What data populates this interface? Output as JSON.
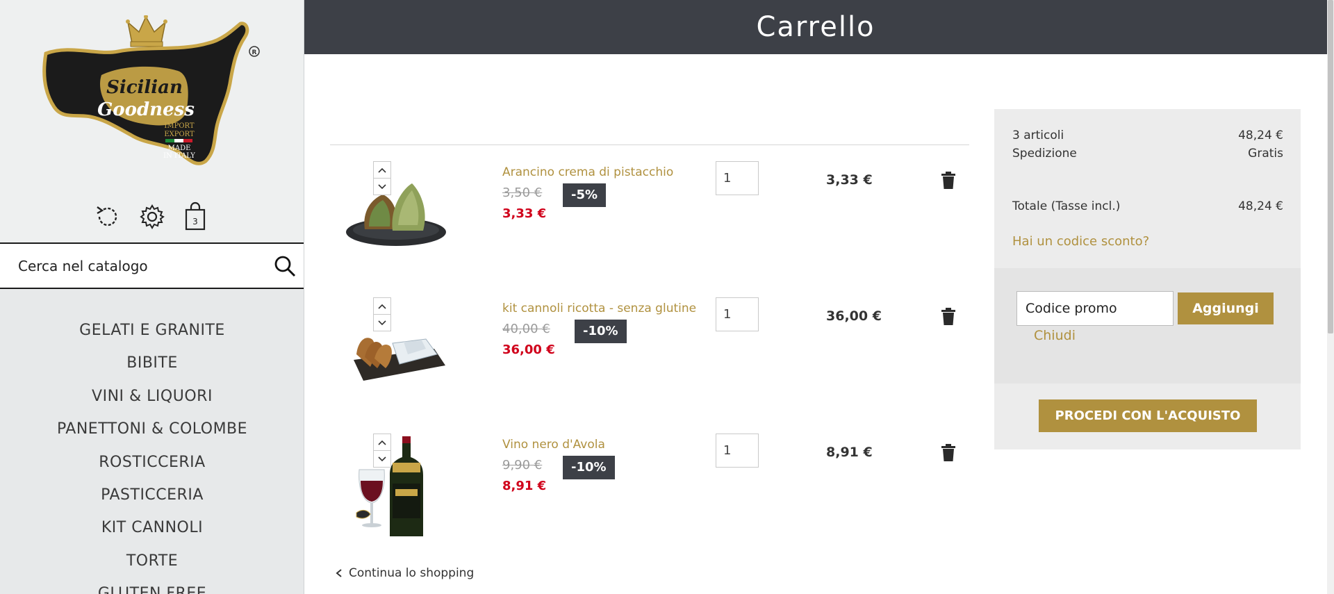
{
  "brand": {
    "name_line1": "Sicilian",
    "name_line2": "Goodness",
    "tag1": "IMPORT",
    "tag2": "EXPORT",
    "tag3": "MADE",
    "tag4": "IN ITALY",
    "registered": "®"
  },
  "colors": {
    "header_bg": "#3d4047",
    "accent_gold": "#b0913f",
    "price_red": "#d0021b",
    "badge_bg": "#3d4047",
    "summary_bg": "#ececec"
  },
  "sidebar": {
    "icons": [
      {
        "name": "history-icon"
      },
      {
        "name": "gear-icon"
      },
      {
        "name": "shopping-bag-icon"
      }
    ],
    "cart_count": "3",
    "search": {
      "placeholder": "Cerca nel catalogo"
    },
    "categories": [
      {
        "label": "GELATI E GRANITE"
      },
      {
        "label": "BIBITE"
      },
      {
        "label": "VINI & LIQUORI"
      },
      {
        "label": "PANETTONI & COLOMBE"
      },
      {
        "label": "ROSTICCERIA"
      },
      {
        "label": "PASTICCERIA"
      },
      {
        "label": "KIT CANNOLI"
      },
      {
        "label": "TORTE"
      },
      {
        "label": "GLUTEN FREE"
      }
    ]
  },
  "header": {
    "title": "Carrello"
  },
  "cart": {
    "items": [
      {
        "name": "Arancino crema di pistacchio",
        "old_price": "3,50 €",
        "discount": "-5%",
        "price": "3,33 €",
        "qty": "1",
        "total": "3,33 €"
      },
      {
        "name": "kit cannoli ricotta - senza glutine",
        "old_price": "40,00 €",
        "discount": "-10%",
        "price": "36,00 €",
        "qty": "1",
        "total": "36,00 €"
      },
      {
        "name": "Vino nero d'Avola",
        "old_price": "9,90 €",
        "discount": "-10%",
        "price": "8,91 €",
        "qty": "1",
        "total": "8,91 €"
      }
    ],
    "continue_label": "Continua lo shopping"
  },
  "summary": {
    "items_label": "3 articoli",
    "items_value": "48,24 €",
    "shipping_label": "Spedizione",
    "shipping_value": "Gratis",
    "total_label": "Totale (Tasse incl.)",
    "total_value": "48,24 €",
    "discount_link": "Hai un codice sconto?",
    "promo_placeholder": "Codice promo",
    "promo_button": "Aggiungi",
    "close_link": "Chiudi",
    "checkout_button": "PROCEDI CON L'ACQUISTO"
  }
}
